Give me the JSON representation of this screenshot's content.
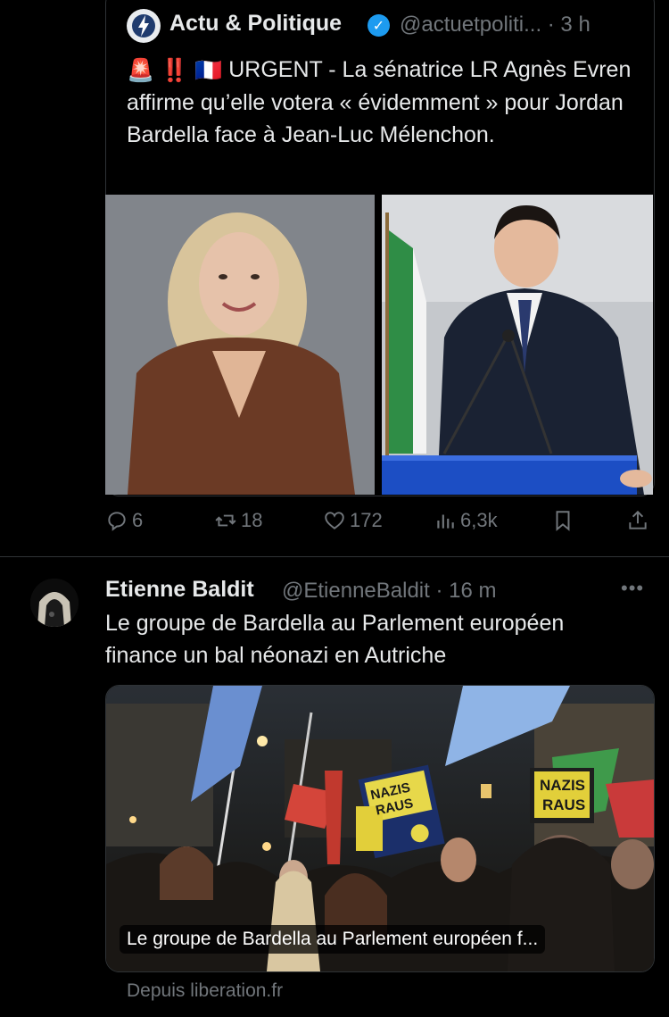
{
  "quoted_tweet": {
    "author_name": "Actu & Politique",
    "handle_time": "@actuetpoliti... · 3 h",
    "emojis": "🚨 ‼️ 🇫🇷",
    "text": "URGENT - La sénatrice LR Agnès Evren affirme qu’elle votera « évidemment » pour Jordan Bardella face à Jean-Luc Mélenchon."
  },
  "actions": {
    "replies": "6",
    "retweets": "18",
    "likes": "172",
    "views": "6,3k"
  },
  "tweet": {
    "author_name": "Etienne Baldit",
    "handle_time": "@EtienneBaldit · 16 m",
    "more": "•••",
    "text": "Le groupe de Bardella au Parlement européen finance un bal néonazi en Autriche",
    "card": {
      "caption": "Le groupe de Bardella au Parlement européen f...",
      "sign_left": "NAZIS RAUS",
      "sign_right": "NAZIS RAUS"
    },
    "source": "Depuis liberation.fr"
  },
  "colors": {
    "background": "#000000",
    "text": "#e7e9ea",
    "muted": "#71767b",
    "border": "#2f3336",
    "verified": "#1d9bf0"
  }
}
